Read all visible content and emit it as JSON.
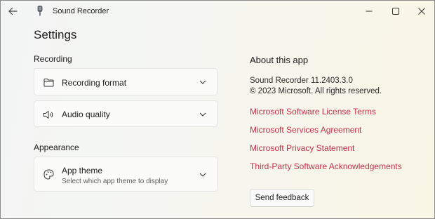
{
  "titlebar": {
    "app_title": "Sound Recorder"
  },
  "page": {
    "title": "Settings"
  },
  "recording": {
    "section_label": "Recording",
    "format_label": "Recording format",
    "quality_label": "Audio quality"
  },
  "appearance": {
    "section_label": "Appearance",
    "theme_label": "App theme",
    "theme_description": "Select which app theme to display"
  },
  "about": {
    "title": "About this app",
    "version": "Sound Recorder 11.2403.3.0",
    "copyright": "© 2023 Microsoft. All rights reserved.",
    "links": [
      "Microsoft Software License Terms",
      "Microsoft Services Agreement",
      "Microsoft Privacy Statement",
      "Third-Party Software Acknowledgements"
    ],
    "feedback_label": "Send feedback"
  },
  "colors": {
    "link": "#c4314b"
  },
  "icons": {
    "back": "back-arrow-icon",
    "app": "microphone-icon",
    "folder": "folder-icon",
    "speaker": "speaker-icon",
    "palette": "palette-icon",
    "chevron": "chevron-down-icon"
  }
}
